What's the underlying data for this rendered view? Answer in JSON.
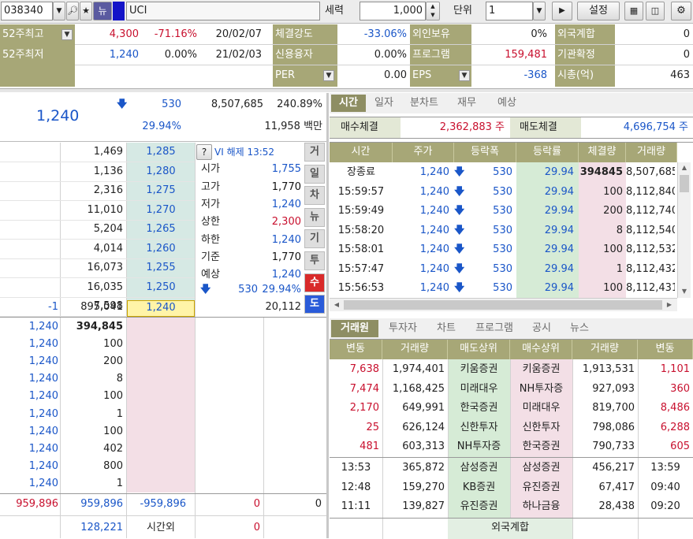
{
  "toolbar": {
    "code": "038340",
    "news_tag": "뉴",
    "name": "UCI",
    "seryeok_label": "세력",
    "seryeok_value": "1,000",
    "unit_label": "단위",
    "unit_value": "1",
    "settings": "설정"
  },
  "summary": {
    "rows": [
      {
        "l1": "52주최고",
        "v1": "4,300",
        "p1": "-71.16%",
        "d1": "20/02/07",
        "l2": "체결강도",
        "v2": "-33.06%",
        "l3": "외인보유",
        "v3": "0%",
        "l4": "외국계합",
        "v4": "0"
      },
      {
        "l1": "52주최저",
        "v1": "1,240",
        "p1": "0.00%",
        "d1": "21/02/03",
        "l2": "신용융자",
        "v2": "0.00%",
        "l3": "프로그램",
        "v3": "159,481",
        "l4": "기관확정",
        "v4": "0"
      },
      {
        "l1": "",
        "v1": "",
        "p1": "",
        "d1": "",
        "l2": "PER",
        "v2": "0.00",
        "l3": "EPS",
        "v3": "-368",
        "l4": "시총(억)",
        "v4": "463"
      }
    ]
  },
  "price": {
    "current": "1,240",
    "change": "530",
    "volume": "8,507,685",
    "vol_ratio": "240.89%",
    "rate": "29.94%",
    "amount": "11,958 백만"
  },
  "orderbook": {
    "ask": [
      {
        "qty": "1,469",
        "price": "1,285"
      },
      {
        "qty": "1,136",
        "price": "1,280"
      },
      {
        "qty": "2,316",
        "price": "1,275"
      },
      {
        "qty": "11,010",
        "price": "1,270"
      },
      {
        "qty": "5,204",
        "price": "1,265"
      },
      {
        "qty": "4,014",
        "price": "1,260"
      },
      {
        "qty": "16,073",
        "price": "1,255"
      },
      {
        "qty": "16,035",
        "price": "1,250"
      },
      {
        "qty": "7,598",
        "price": "1,245"
      }
    ],
    "last": {
      "diff": "-1",
      "qty": "895,041",
      "price": "1,240",
      "right": "20,112"
    },
    "info": [
      {
        "k": "VI 해제 13:52",
        "v": ""
      },
      {
        "k": "시가",
        "v": "1,755"
      },
      {
        "k": "고가",
        "v": "1,770"
      },
      {
        "k": "저가",
        "v": "1,240"
      },
      {
        "k": "상한",
        "v": "2,300"
      },
      {
        "k": "하한",
        "v": "1,240"
      },
      {
        "k": "기준",
        "v": "1,770"
      },
      {
        "k": "예상",
        "v": "1,240"
      }
    ],
    "expect": {
      "change": "530",
      "rate": "29.94%"
    },
    "side_tabs": [
      "거",
      "일",
      "차",
      "뉴",
      "기",
      "투",
      "수",
      "도"
    ],
    "fills": [
      {
        "p": "1,240",
        "q": "394,845"
      },
      {
        "p": "1,240",
        "q": "100"
      },
      {
        "p": "1,240",
        "q": "200"
      },
      {
        "p": "1,240",
        "q": "8"
      },
      {
        "p": "1,240",
        "q": "100"
      },
      {
        "p": "1,240",
        "q": "1"
      },
      {
        "p": "1,240",
        "q": "100"
      },
      {
        "p": "1,240",
        "q": "402"
      },
      {
        "p": "1,240",
        "q": "800"
      },
      {
        "p": "1,240",
        "q": "1"
      }
    ],
    "totals": {
      "a": "959,896",
      "b": "959,896",
      "c": "-959,896",
      "d": "0",
      "e": "0"
    },
    "after": {
      "qty": "128,221",
      "label": "시간외",
      "val": "0"
    }
  },
  "trades": {
    "tabs": [
      "시간",
      "일자",
      "분차트",
      "재무",
      "예상"
    ],
    "buy_label": "매수체결",
    "buy_value": "2,362,883 주",
    "sell_label": "매도체결",
    "sell_value": "4,696,754 주",
    "headers": [
      "시간",
      "주가",
      "등락폭",
      "등락률",
      "체결량",
      "거래량"
    ],
    "rows": [
      {
        "t": "장종료",
        "p": "1,240",
        "c": "530",
        "r": "29.94",
        "q": "394845",
        "v": "8,507,685"
      },
      {
        "t": "15:59:57",
        "p": "1,240",
        "c": "530",
        "r": "29.94",
        "q": "100",
        "v": "8,112,840"
      },
      {
        "t": "15:59:49",
        "p": "1,240",
        "c": "530",
        "r": "29.94",
        "q": "200",
        "v": "8,112,740"
      },
      {
        "t": "15:58:20",
        "p": "1,240",
        "c": "530",
        "r": "29.94",
        "q": "8",
        "v": "8,112,540"
      },
      {
        "t": "15:58:01",
        "p": "1,240",
        "c": "530",
        "r": "29.94",
        "q": "100",
        "v": "8,112,532"
      },
      {
        "t": "15:57:47",
        "p": "1,240",
        "c": "530",
        "r": "29.94",
        "q": "1",
        "v": "8,112,432"
      },
      {
        "t": "15:56:53",
        "p": "1,240",
        "c": "530",
        "r": "29.94",
        "q": "100",
        "v": "8,112,431"
      }
    ]
  },
  "brokers": {
    "tabs": [
      "거래원",
      "투자자",
      "차트",
      "프로그램",
      "공시",
      "뉴스"
    ],
    "headers": [
      "변동",
      "거래량",
      "매도상위",
      "매수상위",
      "거래량",
      "변동"
    ],
    "rows": [
      {
        "ch1": "7,638",
        "v1": "1,974,401",
        "s": "키움증권",
        "b": "키움증권",
        "v2": "1,913,531",
        "ch2": "1,101"
      },
      {
        "ch1": "7,474",
        "v1": "1,168,425",
        "s": "미래대우",
        "b": "NH투자증",
        "v2": "927,093",
        "ch2": "360"
      },
      {
        "ch1": "2,170",
        "v1": "649,991",
        "s": "한국증권",
        "b": "미래대우",
        "v2": "819,700",
        "ch2": "8,486"
      },
      {
        "ch1": "25",
        "v1": "626,124",
        "s": "신한투자",
        "b": "신한투자",
        "v2": "798,086",
        "ch2": "6,288"
      },
      {
        "ch1": "481",
        "v1": "603,313",
        "s": "NH투자증",
        "b": "한국증권",
        "v2": "790,733",
        "ch2": "605"
      }
    ],
    "foreign_rows": [
      {
        "t1": "13:53",
        "v1": "365,872",
        "s": "삼성증권",
        "b": "삼성증권",
        "v2": "456,217",
        "t2": "13:59"
      },
      {
        "t1": "12:48",
        "v1": "159,270",
        "s": "KB증권",
        "b": "유진증권",
        "v2": "67,417",
        "t2": "09:40"
      },
      {
        "t1": "11:11",
        "v1": "139,827",
        "s": "유진증권",
        "b": "하나금융",
        "v2": "28,438",
        "t2": "09:20"
      }
    ],
    "foreign_label": "외국계합"
  },
  "colors": {
    "olive": "#a7a777",
    "tab_active": "#8e8e63",
    "red": "#c8102e",
    "blue": "#1a56c8",
    "pink": "#f3dfe6",
    "green": "#d6ebd6"
  }
}
